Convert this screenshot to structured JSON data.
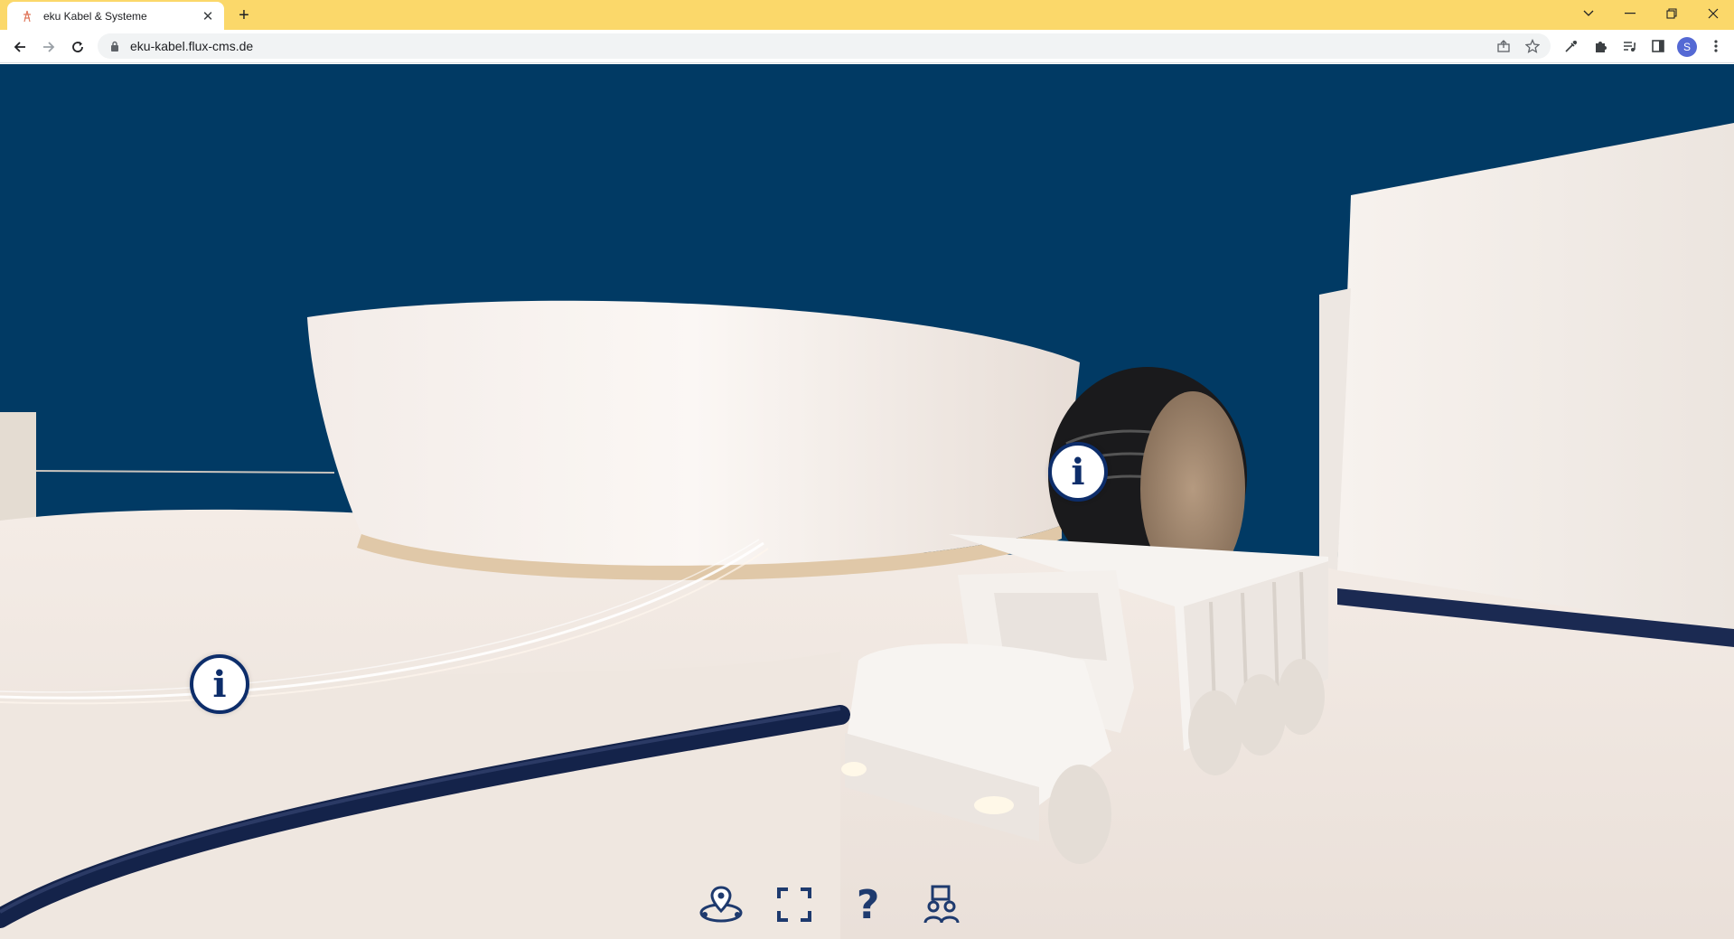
{
  "browser": {
    "tab": {
      "title": "eku Kabel & Systeme",
      "favicon": "eku-pylon-favicon",
      "close_icon": "close-icon"
    },
    "new_tab_icon": "plus-icon",
    "window_controls": [
      "chevron-down-icon",
      "minimize-icon",
      "restore-icon",
      "close-icon"
    ],
    "url": "eku-kabel.flux-cms.de",
    "nav": [
      "back-arrow-icon",
      "forward-arrow-icon",
      "reload-icon"
    ],
    "omnibox_actions": [
      "share-icon",
      "bookmark-star-icon"
    ],
    "extensions": [
      "eyedropper-icon",
      "puzzle-extension-icon",
      "media-queue-icon",
      "side-panel-icon"
    ],
    "profile_initial": "S",
    "menu_icon": "vertical-dots-icon"
  },
  "scene": {
    "background_color": "#013a64",
    "hotspots": [
      {
        "id": "cable-info",
        "label": "i"
      },
      {
        "id": "truck-info",
        "label": "i"
      }
    ],
    "controls": [
      {
        "name": "location-map-icon"
      },
      {
        "name": "fullscreen-icon"
      },
      {
        "name": "help-question-icon",
        "label": "?"
      },
      {
        "name": "contact-people-icon"
      }
    ]
  },
  "colors": {
    "tabbar": "#fbd86a",
    "accent_navy": "#0d2d6a",
    "floor": "#f1e9e2"
  }
}
